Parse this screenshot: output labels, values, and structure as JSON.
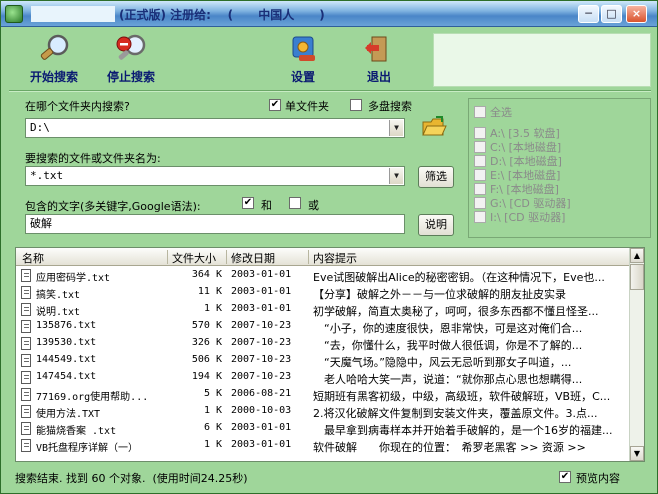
{
  "window": {
    "title": "(正式版) 注册给:    (      中国人      )",
    "controls": {
      "minimize": "─",
      "maximize": "□",
      "close": "×"
    }
  },
  "toolbar": {
    "start_search": "开始搜索",
    "stop_search": "停止搜索",
    "settings": "设置",
    "exit": "退出"
  },
  "search": {
    "folder_label": "在哪个文件夹内搜索?",
    "single_folder_label": "单文件夹",
    "single_folder_checked": "✔",
    "multi_disk_label": "多盘搜索",
    "multi_disk_checked": "",
    "folder_value": "D:\\",
    "name_label": "要搜索的文件或文件夹名为:",
    "name_value": "*.txt",
    "filter_button": "筛选",
    "text_label": "包含的文字(多关键字,Google语法):",
    "and_label": "和",
    "and_checked": "✔",
    "or_label": "或",
    "or_checked": "",
    "text_value": "破解",
    "help_button": "说明"
  },
  "drives": {
    "select_all_label": "全选",
    "items": [
      {
        "label": "A:\\ [3.5 软盘]"
      },
      {
        "label": "C:\\ [本地磁盘]"
      },
      {
        "label": "D:\\ [本地磁盘]"
      },
      {
        "label": "E:\\ [本地磁盘]"
      },
      {
        "label": "F:\\ [本地磁盘]"
      },
      {
        "label": "G:\\ [CD 驱动器]"
      },
      {
        "label": "I:\\ [CD 驱动器]"
      }
    ]
  },
  "results": {
    "columns": [
      "名称",
      "文件大小",
      "修改日期",
      "内容提示"
    ],
    "rows": [
      {
        "name": "应用密码学.txt",
        "size": "364 K",
        "date": "2003-01-01",
        "hint": "Eve试图破解出Alice的秘密密钥。（在这种情况下，Eve也..."
      },
      {
        "name": "搞笑.txt",
        "size": "11 K",
        "date": "2003-01-01",
        "hint": "【分享】破解之外－－与一位求破解的朋友扯皮实录"
      },
      {
        "name": "说明.txt",
        "size": "1 K",
        "date": "2003-01-01",
        "hint": "初学破解，简直太奥秘了，呵呵，很多东西都不懂且怪圣..."
      },
      {
        "name": "135876.txt",
        "size": "570 K",
        "date": "2007-10-23",
        "hint": "　“小子，你的速度很快，恩非常快，可是这对俺们合..."
      },
      {
        "name": "139530.txt",
        "size": "326 K",
        "date": "2007-10-23",
        "hint": "　“去，你懂什么，我平时做人很低调，你是不了解的..."
      },
      {
        "name": "144549.txt",
        "size": "506 K",
        "date": "2007-10-23",
        "hint": "　“天魔气场。”隐隐中，风云无忌听到那女子叫道，..."
      },
      {
        "name": "147454.txt",
        "size": "194 K",
        "date": "2007-10-23",
        "hint": "　老人哈哈大笑一声，说道：“就你那点心思也想瞒得..."
      },
      {
        "name": "77169.org使用帮助...",
        "size": "5 K",
        "date": "2006-08-21",
        "hint": "短期班有黑客初级，中级，高级班，软件破解班，VB班，C..."
      },
      {
        "name": "使用方法.TXT",
        "size": "1 K",
        "date": "2000-10-03",
        "hint": "2.将汉化破解文件复制到安装文件夹，覆盖原文件。3.点..."
      },
      {
        "name": "能猫烧香案 .txt",
        "size": "6 K",
        "date": "2003-01-01",
        "hint": "　最早拿到病毒样本并开始着手破解的，是一个16岁的福建..."
      },
      {
        "name": "VB托盘程序详解（一）",
        "size": "1 K",
        "date": "2003-01-01",
        "hint": "软件破解　　你现在的位置：　希罗老黑客 >> 资源 >>"
      }
    ]
  },
  "status": {
    "text": "搜索结束. 找到 60 个对象.  (使用时间24.25秒)",
    "preview_label": "预览内容",
    "preview_checked": "✔"
  }
}
